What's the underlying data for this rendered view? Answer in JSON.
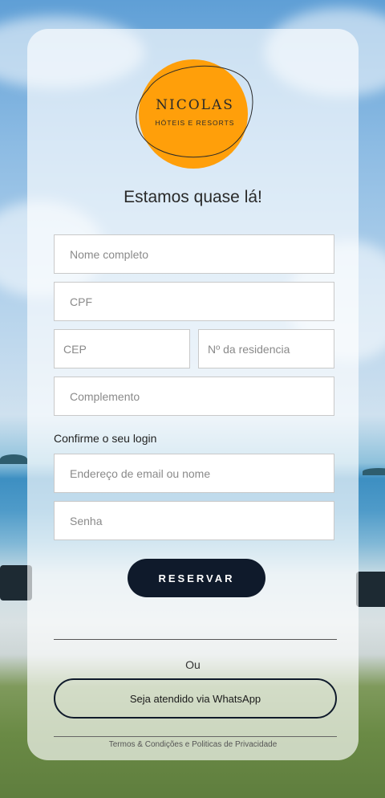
{
  "logo": {
    "name": "NICOLAS",
    "tagline": "HÓTEIS E RESORTS",
    "color": "#ff9f0a"
  },
  "heading": "Estamos quase lá!",
  "fields": {
    "full_name": "Nome completo",
    "cpf": "CPF",
    "cep": "CEP",
    "house_number": "Nº da residencia",
    "complement": "Complemento",
    "login_section_label": "Confirme o seu login",
    "email_or_name": "Endereço de email ou nome",
    "password": "Senha"
  },
  "reserve_button": "RESERVAR",
  "or_label": "Ou",
  "whatsapp_button": "Seja atendido via WhatsApp",
  "footer": {
    "terms": "Termos & Condições",
    "and": "e",
    "privacy": "Politicas de Privacidade"
  },
  "colors": {
    "primary_dark": "#0f1a2b",
    "logo_orange": "#ff9f0a"
  }
}
